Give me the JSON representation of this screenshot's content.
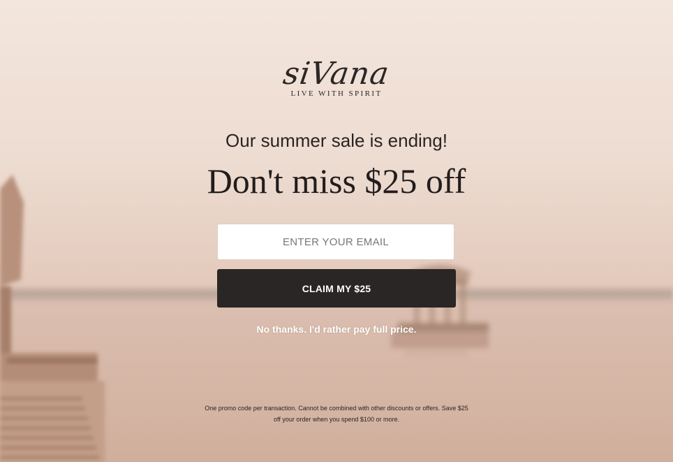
{
  "brand": {
    "name": "siVana",
    "tagline": "LIVE WITH SPIRIT"
  },
  "offer": {
    "subheadline": "Our summer sale is ending!",
    "headline": "Don't miss $25 off"
  },
  "form": {
    "email_placeholder": "ENTER YOUR EMAIL",
    "email_value": "",
    "claim_label": "CLAIM MY $25",
    "decline_label": "No thanks. I'd rather pay full price."
  },
  "disclaimer": "One promo code per transaction. Cannot be combined with other discounts or offers. Save $25 off your order when you spend $100 or more.",
  "colors": {
    "button_bg": "#2b2626",
    "button_text": "#ffffff",
    "text_dark": "#221c1c",
    "background_tint": "#e8d4c8"
  }
}
